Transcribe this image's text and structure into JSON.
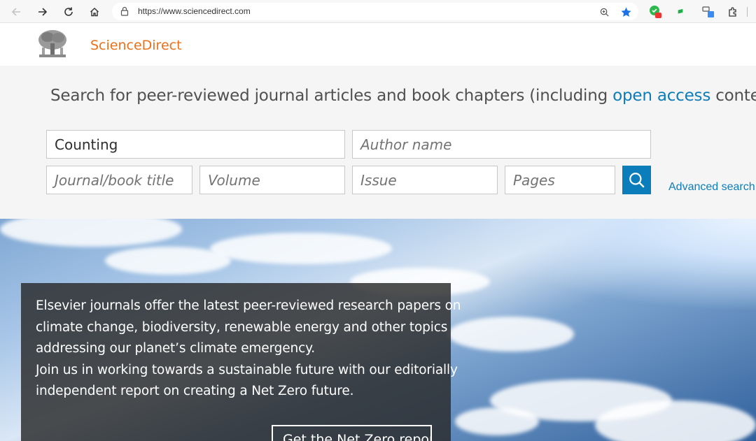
{
  "browser": {
    "url": "https://www.sciencedirect.com",
    "accent": "#1a73e8"
  },
  "header": {
    "brand": "ScienceDirect",
    "brand_color": "#e9711c"
  },
  "search": {
    "heading_prefix": "Search for peer-reviewed journal articles and book chapters (including ",
    "heading_link": "open access",
    "heading_suffix": " content)",
    "keywords_value": "Counting",
    "author_placeholder": "Author name",
    "journal_placeholder": "Journal/book title",
    "volume_placeholder": "Volume",
    "issue_placeholder": "Issue",
    "pages_placeholder": "Pages",
    "advanced_label": "Advanced search",
    "accent": "#0c7dbb"
  },
  "promo": {
    "lines": [
      "Elsevier journals offer the latest peer-reviewed research papers on",
      "climate change, biodiversity, renewable energy and other topics",
      "addressing our planet’s climate emergency.",
      "Join us in working towards a sustainable future with our editorially",
      "independent report on creating a Net Zero future."
    ],
    "button_label": "Get the Net Zero report"
  }
}
